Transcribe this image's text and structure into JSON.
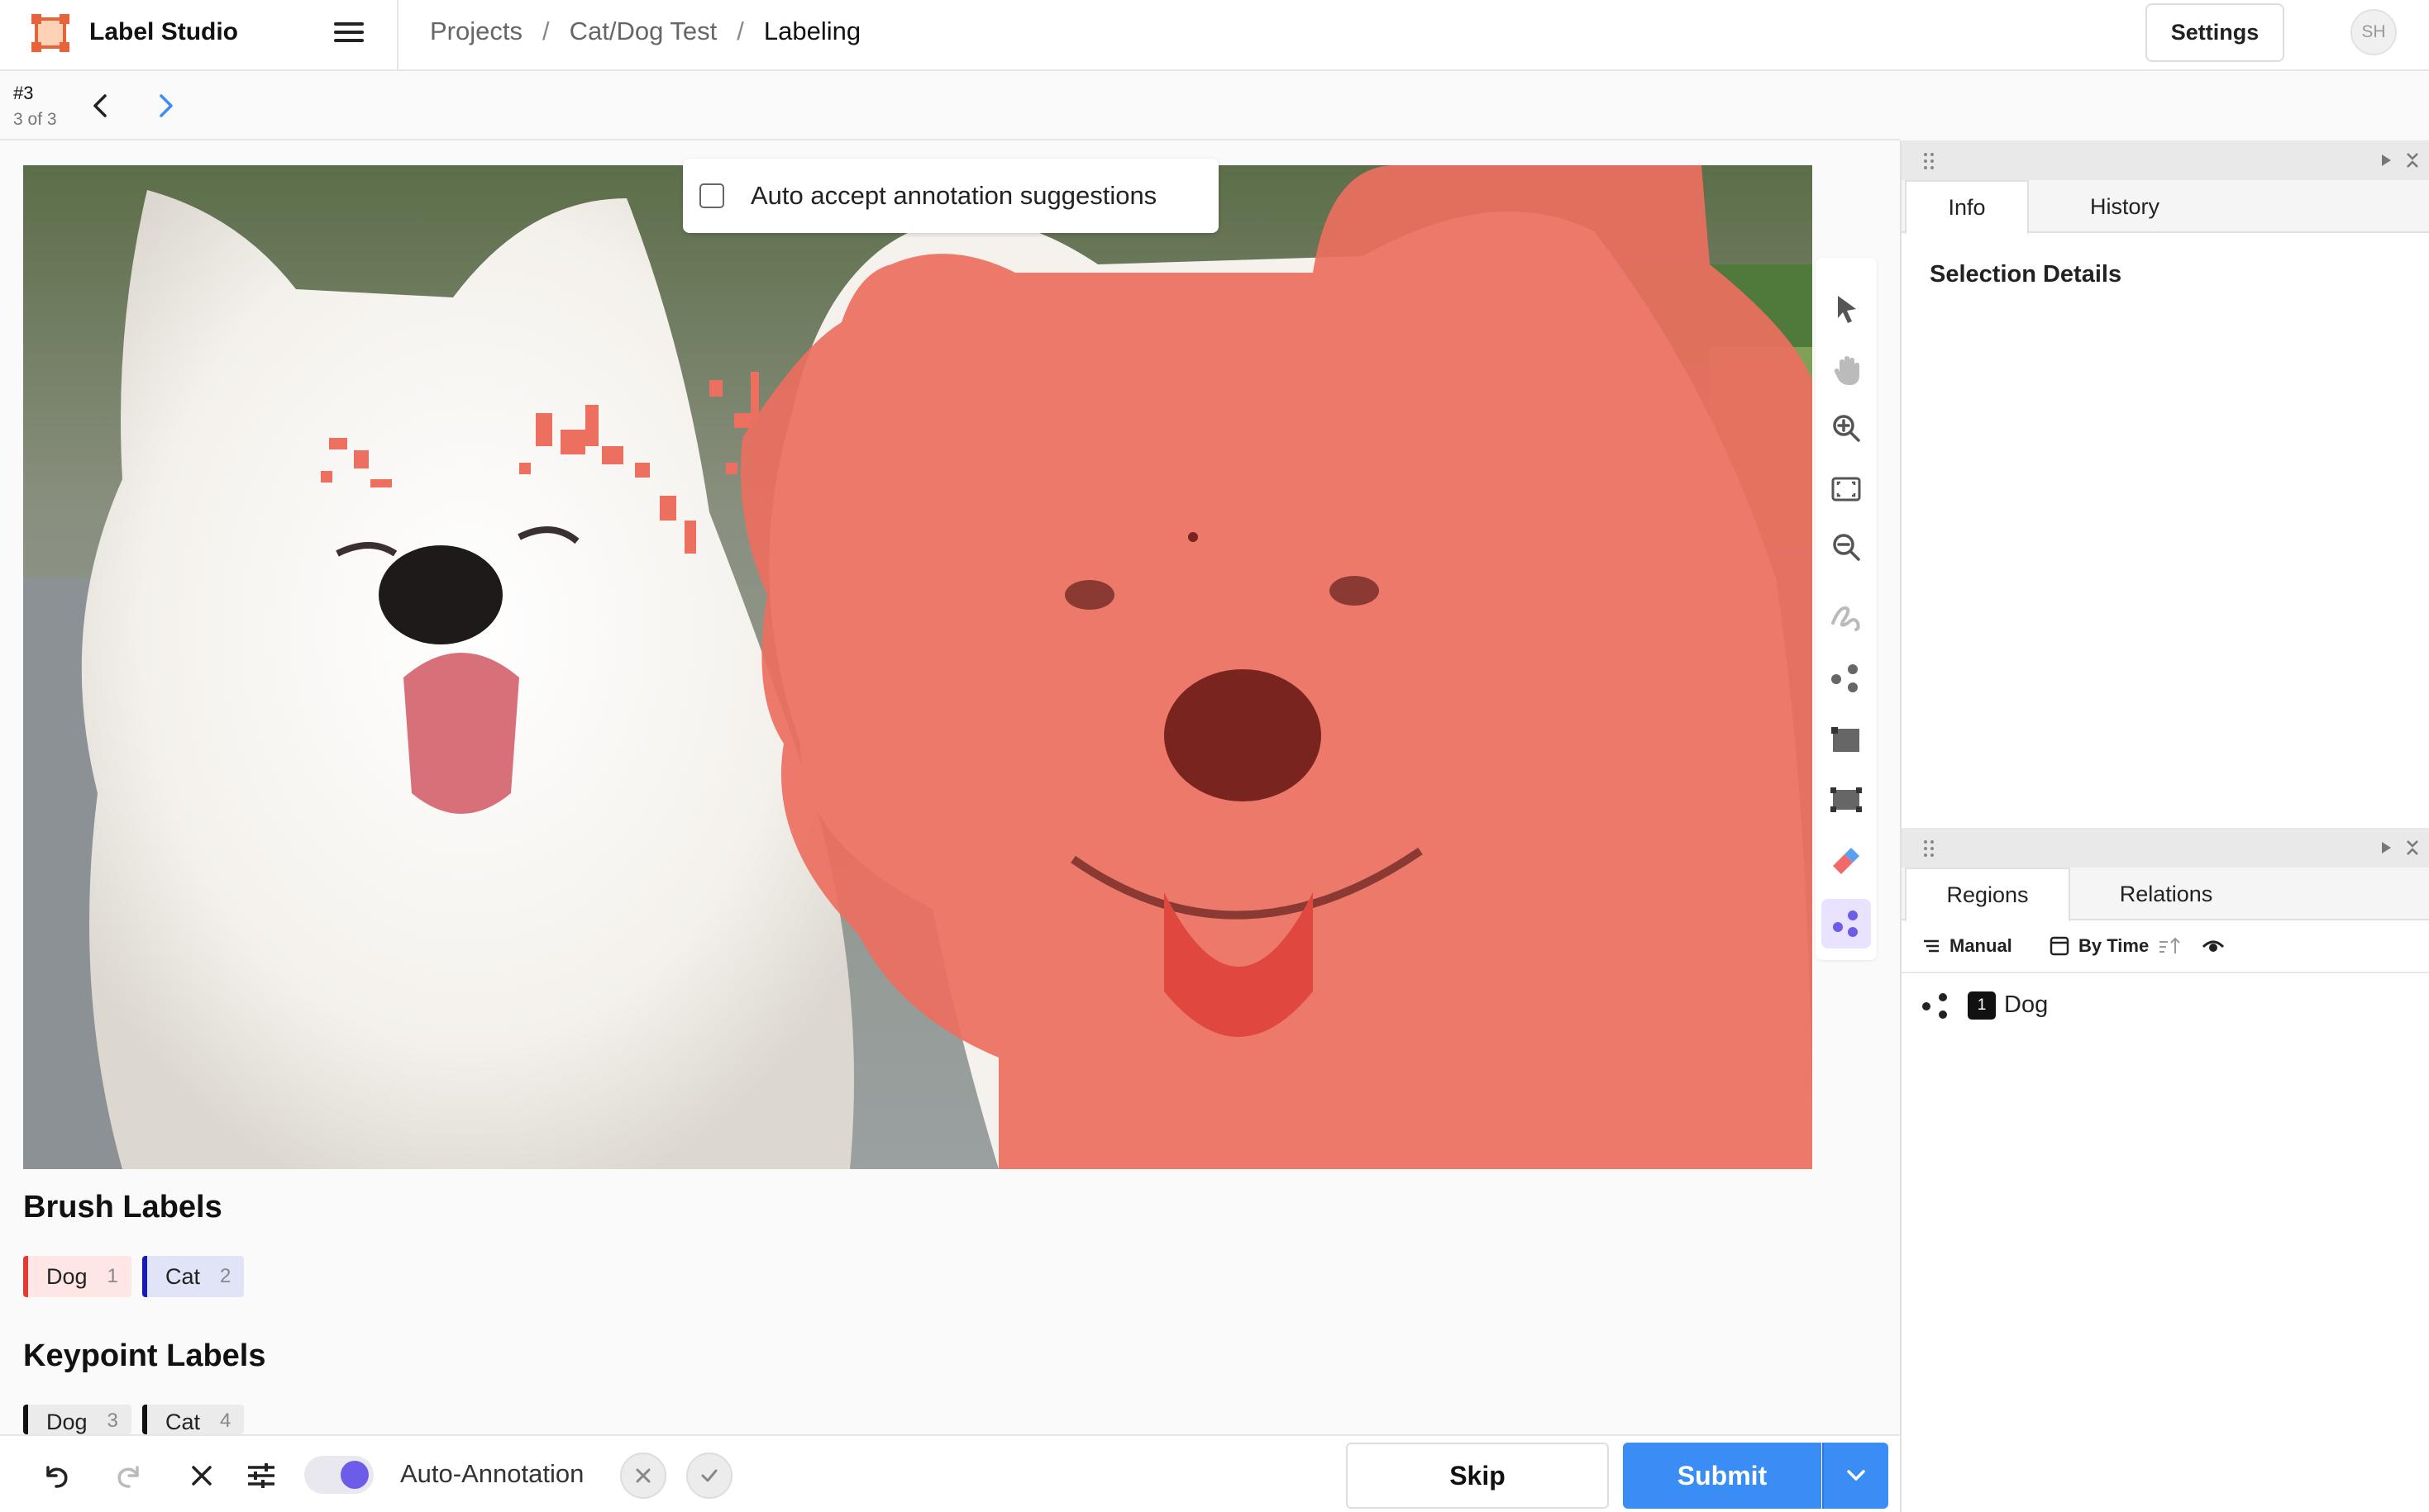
{
  "app": {
    "title": "Label Studio"
  },
  "breadcrumb": {
    "projects": "Projects",
    "project": "Cat/Dog Test",
    "current": "Labeling",
    "separator": "/"
  },
  "header": {
    "settings_label": "Settings",
    "avatar_initials": "SH"
  },
  "task": {
    "id": "#3",
    "count": "3 of 3"
  },
  "auto_accept": {
    "label": "Auto accept annotation suggestions",
    "checked": false
  },
  "brush_labels": {
    "title": "Brush Labels",
    "items": [
      {
        "label": "Dog",
        "hotkey": "1",
        "color": "#e53935"
      },
      {
        "label": "Cat",
        "hotkey": "2",
        "color": "#1a1ab8"
      }
    ]
  },
  "keypoint_labels": {
    "title": "Keypoint Labels",
    "items": [
      {
        "label": "Dog",
        "hotkey": "3",
        "color": "#111111"
      },
      {
        "label": "Cat",
        "hotkey": "4",
        "color": "#111111"
      }
    ]
  },
  "toolbar_tools": [
    "cursor-icon",
    "hand-icon",
    "zoom-in-icon",
    "fit-screen-icon",
    "zoom-out-icon",
    "brush-icon",
    "keypoint-icon",
    "rectangle-icon",
    "rectangle-3point-icon",
    "eraser-icon",
    "magic-wand-icon"
  ],
  "bottom": {
    "auto_annotation_label": "Auto-Annotation",
    "auto_annotation_on": true,
    "skip_label": "Skip",
    "submit_label": "Submit"
  },
  "info_panel": {
    "tabs": [
      "Info",
      "History"
    ],
    "active_tab": "Info",
    "selection_title": "Selection Details"
  },
  "regions_panel": {
    "tabs": [
      "Regions",
      "Relations"
    ],
    "active_tab": "Regions",
    "grouping": "Manual",
    "sort": "By Time",
    "regions": [
      {
        "index": "1",
        "label": "Dog",
        "type": "keypoint-icon"
      }
    ]
  },
  "colors": {
    "accent": "#3a8df4",
    "brush_overlay": "#ec6f60",
    "tool_active": "#6d5ce8"
  }
}
